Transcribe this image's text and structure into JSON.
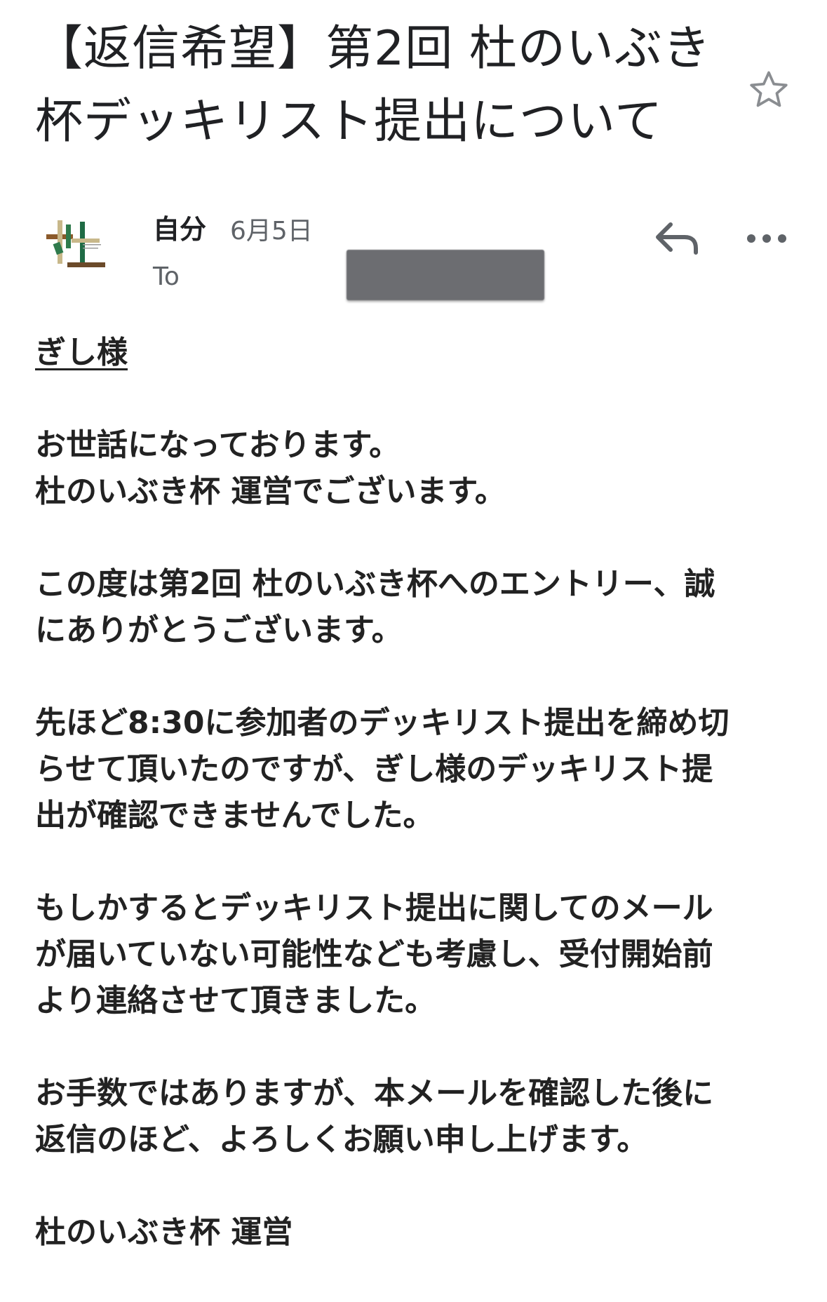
{
  "email": {
    "subject_lines": [
      "【返信希望】第2回 杜のいぶき",
      "杯デッキリスト提出について"
    ],
    "sender": "自分",
    "date": "6月5日",
    "to_label": "To"
  },
  "icons": {
    "star": "star-outline-icon",
    "reply": "reply-arrow-icon",
    "more": "more-horizontal-icon",
    "avatar": "mori-no-ibuki-logo"
  },
  "body": {
    "greeting": "ぎし様",
    "paragraphs": [
      [
        "お世話になっております。",
        "杜のいぶき杯 運営でございます。"
      ],
      [
        "この度は第2回 杜のいぶき杯へのエントリー、誠",
        "にありがとうございます。"
      ],
      [
        "先ほど8:30に参加者のデッキリスト提出を締め切",
        "らせて頂いたのですが、ぎし様のデッキリスト提",
        "出が確認できませんでした。"
      ],
      [
        "もしかするとデッキリスト提出に関してのメール",
        "が届いていない可能性なども考慮し、受付開始前",
        "より連絡させて頂きました。"
      ],
      [
        "お手数ではありますが、本メールを確認した後に",
        "返信のほど、よろしくお願い申し上げます。"
      ],
      [
        "杜のいぶき杯 運営"
      ]
    ]
  },
  "colors": {
    "text": "#222222",
    "meta": "#5f6368",
    "redaction": "#6c6d71"
  }
}
